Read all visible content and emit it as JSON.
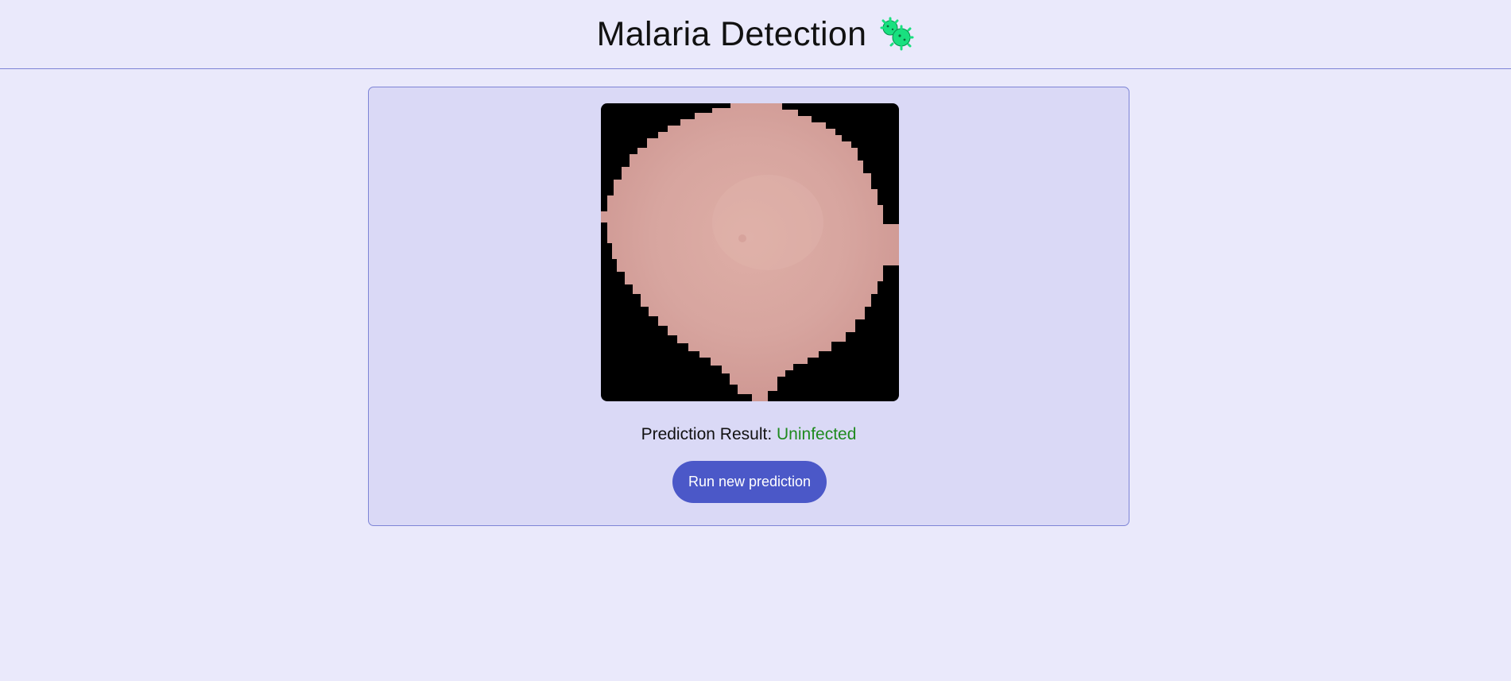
{
  "header": {
    "title": "Malaria Detection",
    "icon": "microbe-icon",
    "icon_color": "#19e07f"
  },
  "main": {
    "image_alt": "blood cell image",
    "result_label": "Prediction Result:",
    "result_value": "Uninfected",
    "result_color": "#1f8a1f",
    "run_button_label": "Run new prediction"
  },
  "colors": {
    "background": "#eae9fb",
    "card_background": "#dad9f6",
    "accent": "#4b58c8",
    "border": "#7d84d6"
  }
}
